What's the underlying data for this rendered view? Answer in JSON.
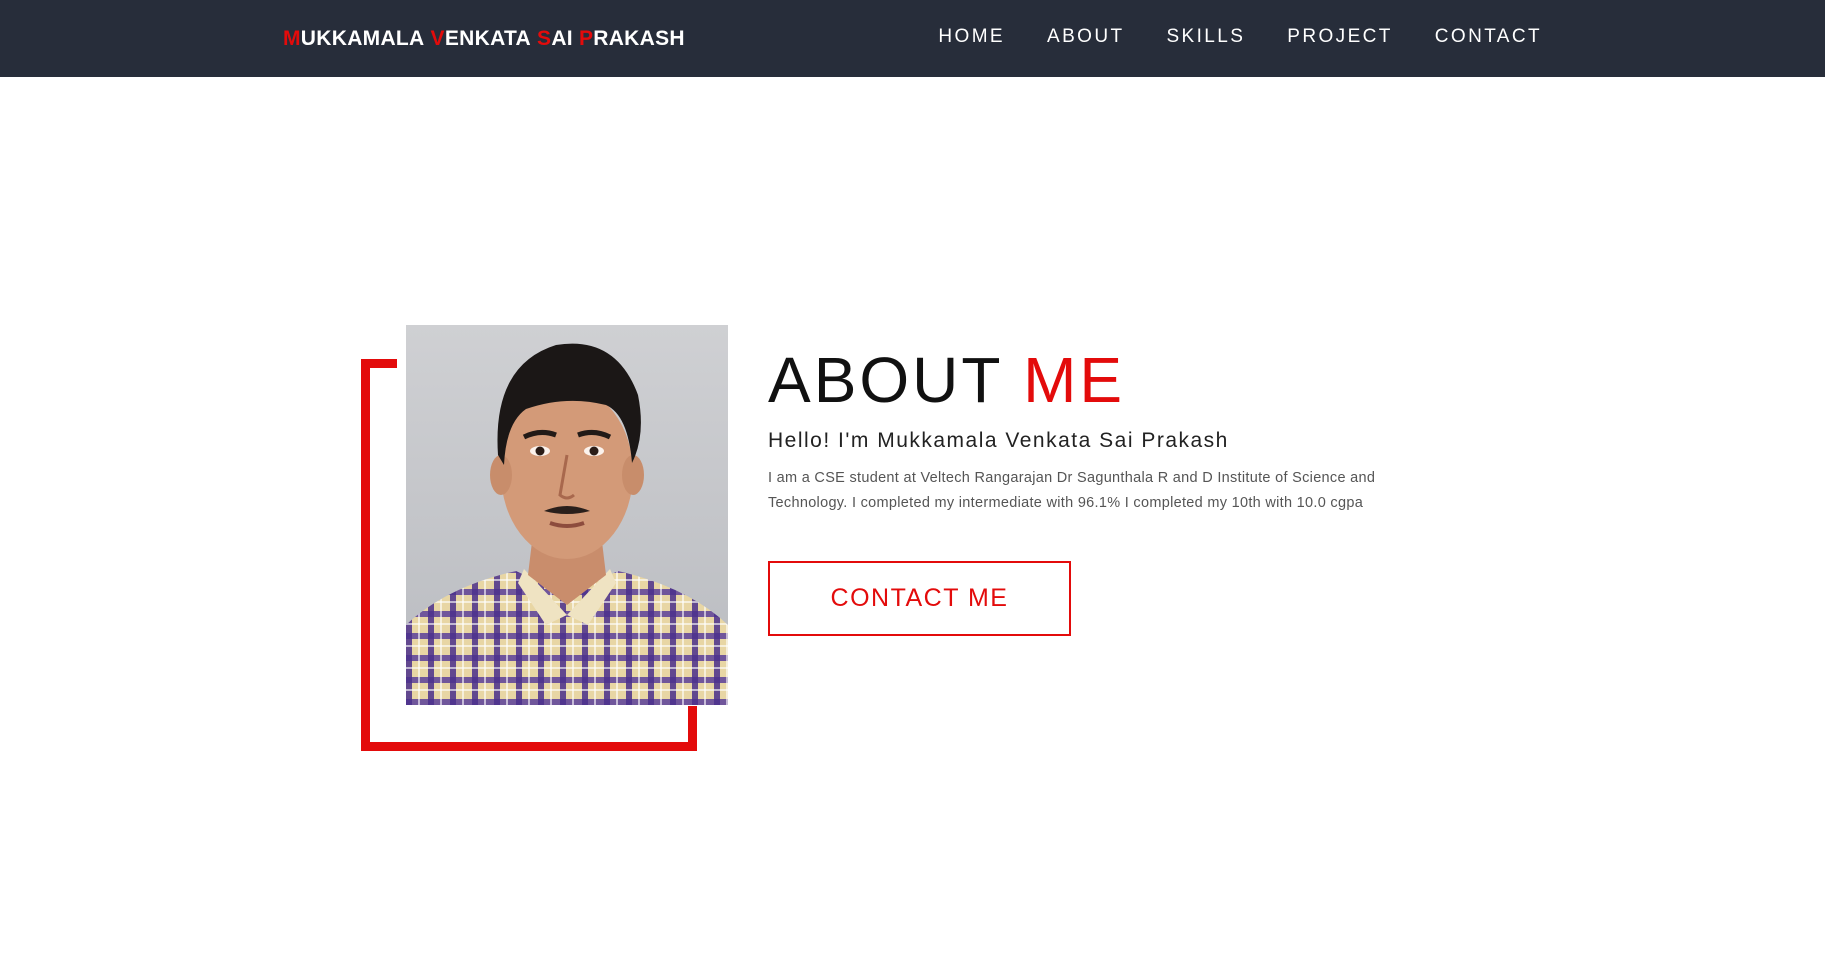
{
  "brand": {
    "words": [
      {
        "initial": "M",
        "rest": "UKKAMALA"
      },
      {
        "initial": "V",
        "rest": "ENKATA"
      },
      {
        "initial": "S",
        "rest": "AI"
      },
      {
        "initial": "P",
        "rest": "RAKASH"
      }
    ]
  },
  "nav": {
    "items": [
      "HOME",
      "ABOUT",
      "SKILLS",
      "PROJECT",
      "CONTACT"
    ]
  },
  "about": {
    "title_main": "ABOUT",
    "title_accent": "ME",
    "greeting": "Hello! I'm Mukkamala Venkata Sai Prakash",
    "description": "I am a CSE student at Veltech Rangarajan Dr Sagunthala R and D Institute of Science and Technology. I completed my intermediate with 96.1% I completed my 10th with 10.0 cgpa",
    "button_label": "CONTACT ME"
  },
  "colors": {
    "navbar_bg": "#272d3a",
    "accent": "#e30b0b",
    "text_dark": "#111111"
  }
}
